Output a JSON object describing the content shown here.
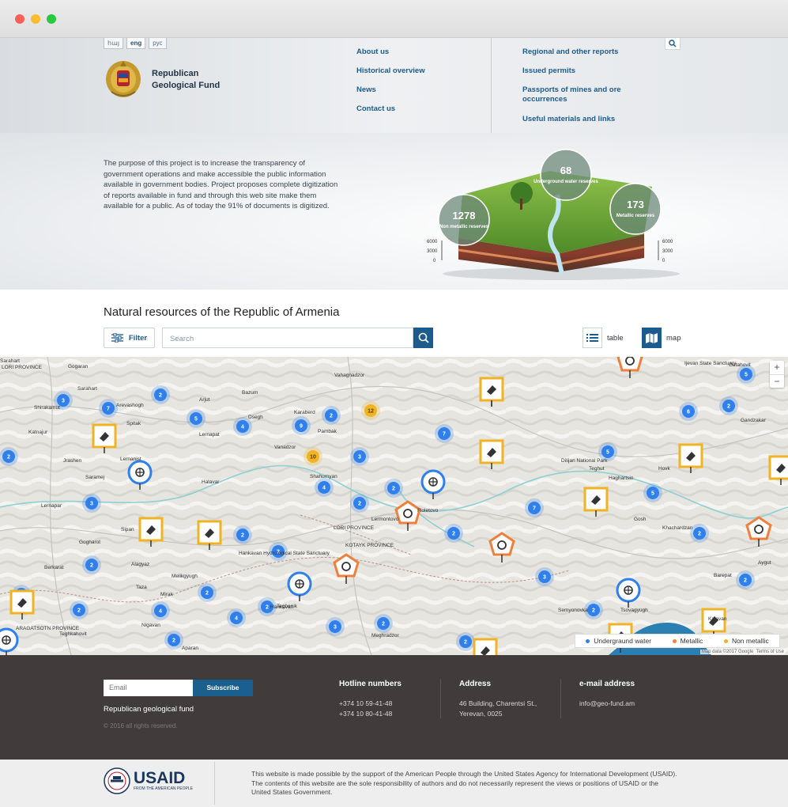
{
  "languages": [
    "հայ",
    "eng",
    "рус"
  ],
  "brand": {
    "line1": "Republican",
    "line2": "Geological Fund"
  },
  "nav": {
    "col1": [
      "About us",
      "Historical overview",
      "News",
      "Contact us"
    ],
    "col2": [
      "Regional and other reports",
      "Issued permits",
      "Passports of mines and ore",
      "occurrences",
      "Useful materials and links"
    ]
  },
  "hero": {
    "text": "The purpose of this project is to increase the transparency of government operations and make accessible the public information available in government bodies. Project proposes complete digitization of reports available in fund and through this web site make them available for a public. As of today the 91% of documents is digitized.",
    "stats": [
      {
        "value": "68",
        "label": "Underground water reserves"
      },
      {
        "value": "1278",
        "label": "Non metallic reserves"
      },
      {
        "value": "173",
        "label": "Metallic reserves"
      }
    ],
    "depth_ticks": [
      "6000",
      "3000",
      "0"
    ]
  },
  "resources": {
    "title": "Natural resources of the Republic of Armenia",
    "filter_label": "Filter",
    "search_placeholder": "Search",
    "view_table": "table",
    "view_map": "map"
  },
  "map": {
    "zoom_in": "+",
    "zoom_out": "−",
    "legend": [
      "Undergraund water",
      "Metallic",
      "Non metallic"
    ],
    "legend_colors": [
      "#2f80ed",
      "#f07f3c",
      "#f0b323"
    ],
    "attribution_data": "Map data ©2017 Google",
    "attribution_terms": "Terms of Use",
    "places": [
      "LORI PROVINCE",
      "Gogaran",
      "Sarahart",
      "Shirakamut",
      "Katnajur",
      "Arevashogh",
      "Spitak",
      "Arjut",
      "Bazum",
      "Vahagnadzor",
      "Dsegh",
      "Karaberd",
      "Pambak",
      "Vanadzor",
      "Lernapat",
      "Jrashen",
      "Saramej",
      "Lernanist",
      "Halavar",
      "Shahumyan",
      "Lernapar",
      "Sipan",
      "Gogharot",
      "Berkarat",
      "Alagyaz",
      "Melikgyugh",
      "Taza",
      "Mirak",
      "Hankavan Hydrological State Sanctuary",
      "Teghut",
      "Dilijan National Park",
      "Haghartsin",
      "Hovk",
      "Gosh",
      "Khachardzan",
      "Semyonovka",
      "Tsovagyugh",
      "Kalavan",
      "Barepat",
      "Ijevan State Sanctuary",
      "Getahovit",
      "Gandzakar",
      "Aygut",
      "Fioletovo",
      "LORI PROVINCE",
      "KOTAYK PROVINCE",
      "ARAGATSOTN PROVINCE",
      "Teghenik",
      "Nigavan",
      "Aparan",
      "Meghradzor",
      "Hankavan",
      "Teghkahovit",
      "Sarahart",
      "Lermontovo"
    ],
    "clusters": [
      {
        "n": "3",
        "c": "blue"
      },
      {
        "n": "7",
        "c": "blue"
      },
      {
        "n": "2",
        "c": "blue"
      },
      {
        "n": "5",
        "c": "blue"
      },
      {
        "n": "4",
        "c": "blue"
      },
      {
        "n": "9",
        "c": "blue"
      },
      {
        "n": "2",
        "c": "blue"
      },
      {
        "n": "12",
        "c": "yellow"
      },
      {
        "n": "7",
        "c": "blue"
      },
      {
        "n": "10",
        "c": "yellow"
      },
      {
        "n": "3",
        "c": "blue"
      },
      {
        "n": "2",
        "c": "blue"
      },
      {
        "n": "2",
        "c": "blue"
      },
      {
        "n": "7",
        "c": "blue"
      },
      {
        "n": "5",
        "c": "blue"
      },
      {
        "n": "5",
        "c": "blue"
      },
      {
        "n": "6",
        "c": "blue"
      },
      {
        "n": "2",
        "c": "blue"
      },
      {
        "n": "5",
        "c": "blue"
      },
      {
        "n": "2",
        "c": "blue"
      },
      {
        "n": "2",
        "c": "blue"
      },
      {
        "n": "3",
        "c": "blue"
      },
      {
        "n": "2",
        "c": "blue"
      },
      {
        "n": "2",
        "c": "blue"
      },
      {
        "n": "4",
        "c": "blue"
      },
      {
        "n": "3",
        "c": "blue"
      },
      {
        "n": "2",
        "c": "blue"
      },
      {
        "n": "2",
        "c": "blue"
      },
      {
        "n": "2",
        "c": "blue"
      },
      {
        "n": "2",
        "c": "blue"
      },
      {
        "n": "4",
        "c": "blue"
      },
      {
        "n": "2",
        "c": "blue"
      },
      {
        "n": "3",
        "c": "blue"
      },
      {
        "n": "2",
        "c": "blue"
      },
      {
        "n": "2",
        "c": "blue"
      },
      {
        "n": "2",
        "c": "blue"
      },
      {
        "n": "2",
        "c": "blue"
      },
      {
        "n": "4",
        "c": "blue"
      },
      {
        "n": "2",
        "c": "blue"
      },
      {
        "n": "2",
        "c": "blue"
      }
    ]
  },
  "footer": {
    "email_placeholder": "Email",
    "subscribe": "Subscribe",
    "brand": "Republican geological fund",
    "copyright": "© 2016 all rights reserved.",
    "hotline_title": "Hotline numbers",
    "hotline": [
      "+374 10 59-41-48",
      "+374 10 80-41-48"
    ],
    "address_title": "Address",
    "address": [
      "46 Building, Charentsi St.,",
      "Yerevan, 0025"
    ],
    "email_title": "e-mail address",
    "email": "info@geo-fund.am"
  },
  "sponsor": {
    "logo_word": "USAID",
    "logo_sub": "FROM THE AMERICAN PEOPLE",
    "disclaimer": "This website is made possible by the support of the American People through the United States Agency for International Development (USAID). The contents of this website are the sole responsibility of authors and do not necessarily represent the views or positions of USAID or the United States Government."
  }
}
